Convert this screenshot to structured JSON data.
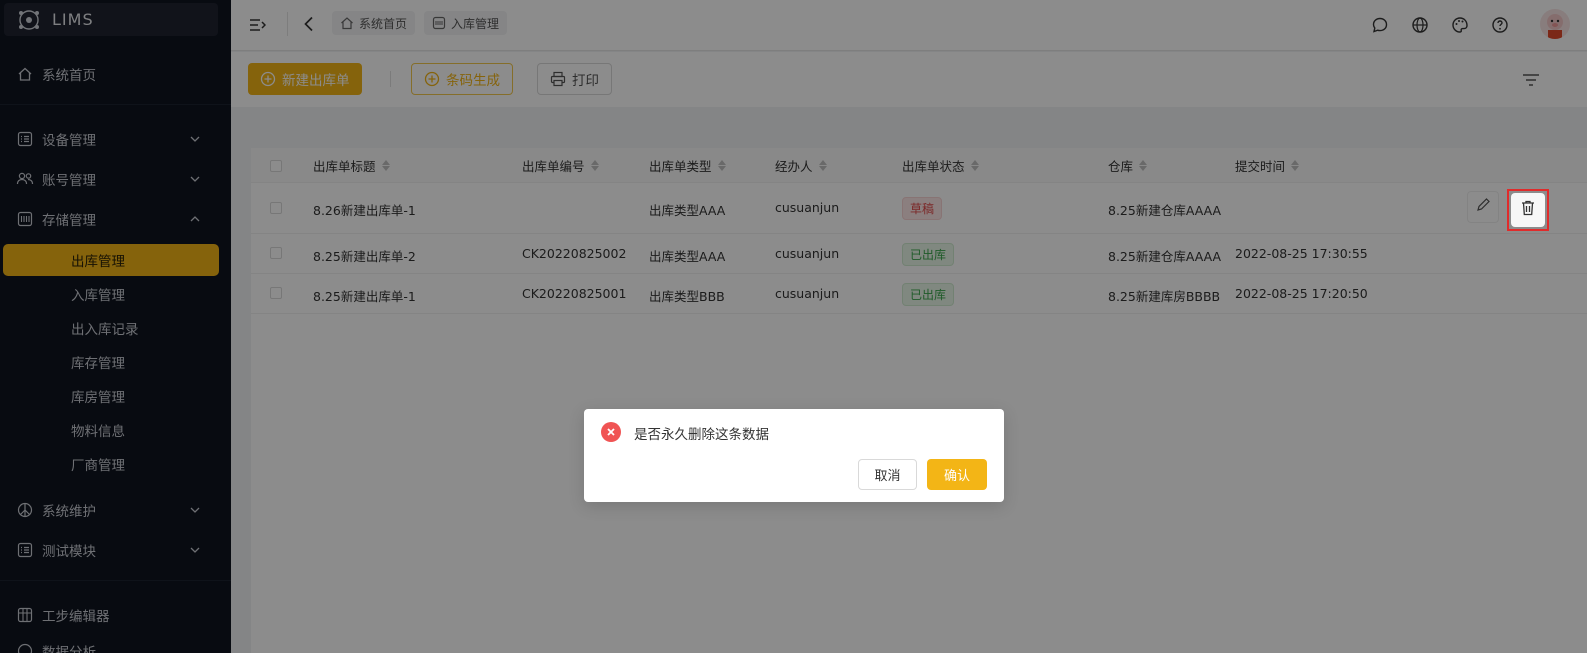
{
  "app": {
    "title": "LIMS"
  },
  "sidebar": {
    "home": "系统首页",
    "groups": [
      {
        "label": "设备管理",
        "icon": "list-icon"
      },
      {
        "label": "账号管理",
        "icon": "users-icon"
      },
      {
        "label": "存储管理",
        "icon": "storage-icon"
      }
    ],
    "storage_items": [
      "出库管理",
      "入库管理",
      "出入库记录",
      "库存管理",
      "库房管理",
      "物料信息",
      "厂商管理"
    ],
    "lower_groups": [
      {
        "label": "系统维护",
        "icon": "peace-icon"
      },
      {
        "label": "测试模块",
        "icon": "list-icon"
      }
    ],
    "extra_items": [
      {
        "label": "工步编辑器",
        "icon": "grid-icon"
      },
      {
        "label": "数据分析",
        "icon": "globe-icon"
      }
    ]
  },
  "header": {
    "breadcrumbs": [
      {
        "label": "系统首页",
        "icon": "home-icon"
      },
      {
        "label": "入库管理",
        "icon": "tag-icon"
      }
    ],
    "right_icons": [
      "message-icon",
      "globe-icon",
      "palette-icon",
      "help-icon",
      "avatar"
    ]
  },
  "toolbar": {
    "new_label": "新建出库单",
    "barcode_label": "条码生成",
    "print_label": "打印"
  },
  "table": {
    "columns": [
      "出库单标题",
      "出库单编号",
      "出库单类型",
      "经办人",
      "出库单状态",
      "仓库",
      "提交时间"
    ],
    "rows": [
      {
        "title": "8.26新建出库单-1",
        "code": "",
        "type": "出库类型AAA",
        "handler": "cusuanjun",
        "status": "草稿",
        "status_kind": "draft",
        "warehouse": "8.25新建仓库AAAA",
        "time": ""
      },
      {
        "title": "8.25新建出库单-2",
        "code": "CK20220825002",
        "type": "出库类型AAA",
        "handler": "cusuanjun",
        "status": "已出库",
        "status_kind": "out",
        "warehouse": "8.25新建仓库AAAA",
        "time": "2022-08-25 17:30:55"
      },
      {
        "title": "8.25新建出库单-1",
        "code": "CK20220825001",
        "type": "出库类型BBB",
        "handler": "cusuanjun",
        "status": "已出库",
        "status_kind": "out",
        "warehouse": "8.25新建库房BBBB",
        "time": "2022-08-25 17:20:50"
      }
    ]
  },
  "modal": {
    "message": "是否永久删除这条数据",
    "cancel": "取消",
    "confirm": "确认"
  },
  "colors": {
    "accent": "#f3b516",
    "sidebar_bg": "#0f1420",
    "danger": "#f05454",
    "success": "#3aa64b"
  }
}
